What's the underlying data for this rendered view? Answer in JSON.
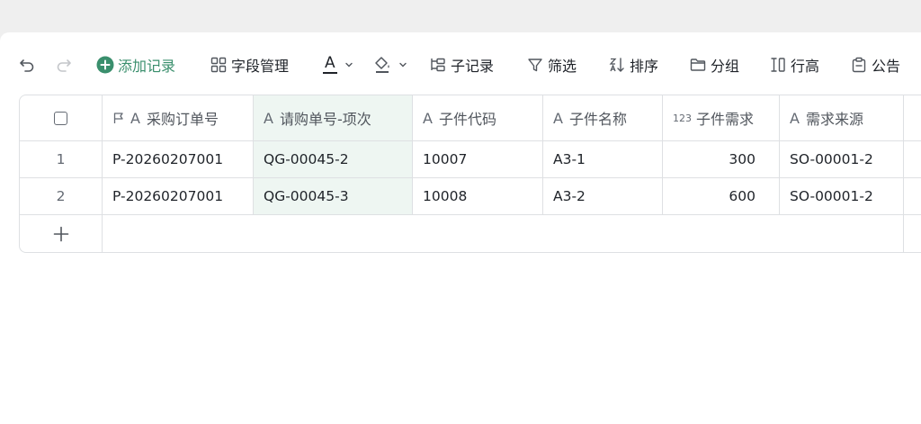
{
  "toolbar": {
    "add_record_label": "添加记录",
    "field_manage_label": "字段管理",
    "sub_record_label": "子记录",
    "filter_label": "筛选",
    "sort_label": "排序",
    "group_label": "分组",
    "row_height_label": "行高",
    "announcement_label": "公告",
    "text_color_letter": "A",
    "accent_color": "#3a8f6d"
  },
  "table": {
    "columns": [
      {
        "label": "采购订单号",
        "type": "text"
      },
      {
        "label": "请购单号-项次",
        "type": "text"
      },
      {
        "label": "子件代码",
        "type": "text"
      },
      {
        "label": "子件名称",
        "type": "text"
      },
      {
        "label": "子件需求",
        "type": "number"
      },
      {
        "label": "需求来源",
        "type": "text"
      }
    ],
    "text_type_glyph": "A",
    "number_type_glyph": "123",
    "rows": [
      {
        "index": "1",
        "cells": [
          "P-20260207001",
          "QG-00045-2",
          "10007",
          "A3-1",
          "300",
          "SO-00001-2"
        ]
      },
      {
        "index": "2",
        "cells": [
          "P-20260207001",
          "QG-00045-3",
          "10008",
          "A3-2",
          "600",
          "SO-00001-2"
        ]
      }
    ]
  }
}
